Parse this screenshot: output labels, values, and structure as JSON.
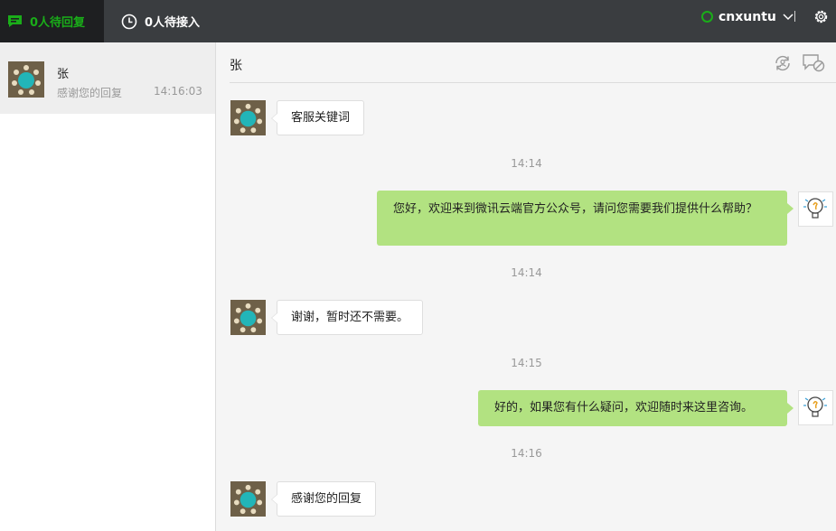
{
  "topbar": {
    "reply_tab": "0人待回复",
    "waiting_tab": "0人待接入",
    "account_name": "cnxuntu",
    "status_color": "#1aad19",
    "icons": [
      "chat-bubble-icon",
      "clock-icon",
      "chevron-down-icon",
      "gear-icon"
    ]
  },
  "sessions": [
    {
      "name": "张",
      "preview": "感谢您的回复",
      "time": "14:16:03"
    }
  ],
  "chat": {
    "title": "张",
    "header_icons": [
      "transfer-icon",
      "end-session-icon"
    ],
    "messages": [
      {
        "side": "left",
        "text": "客服关键词"
      },
      {
        "side": "time",
        "text": "14:14"
      },
      {
        "side": "right",
        "text": "您好，欢迎来到微讯云端官方公众号，请问您需要我们提供什么帮助？"
      },
      {
        "side": "time",
        "text": "14:14"
      },
      {
        "side": "left",
        "text": "谢谢，暂时还不需要。"
      },
      {
        "side": "time",
        "text": "14:15"
      },
      {
        "side": "right",
        "text": "好的，如果您有什么疑问，欢迎随时来这里咨询。"
      },
      {
        "side": "time",
        "text": "14:16"
      },
      {
        "side": "left",
        "text": "感谢您的回复"
      }
    ]
  },
  "colors": {
    "accent_green": "#1aad19",
    "bubble_green": "#b2e281",
    "topbar_bg": "#3a3d40"
  }
}
